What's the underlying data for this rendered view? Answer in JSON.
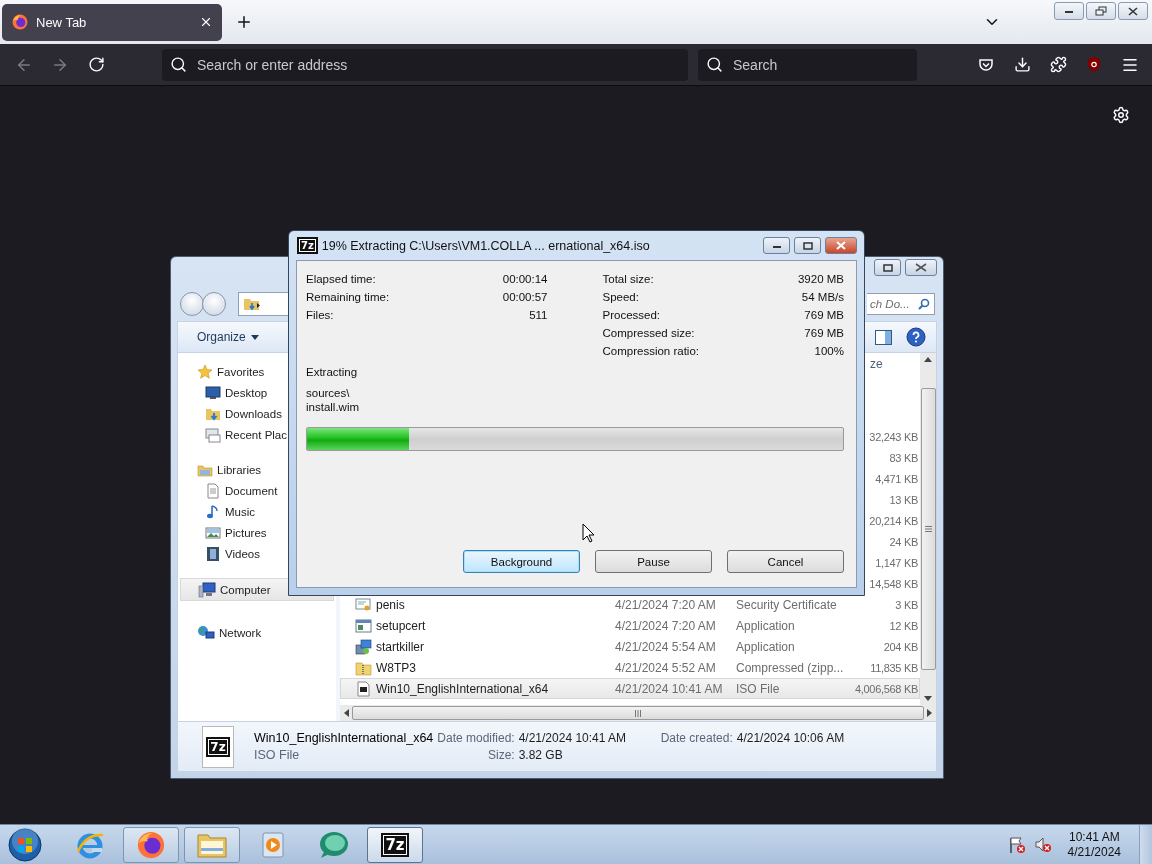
{
  "browser": {
    "tabs": [
      {
        "title": "New Tab",
        "selected": true
      }
    ],
    "nav_buttons": [
      {
        "kind": "back",
        "disabled": true
      },
      {
        "kind": "forward",
        "disabled": true
      },
      {
        "kind": "reload",
        "disabled": false
      }
    ],
    "address_placeholder": "Search or enter address",
    "search_placeholder": "Search",
    "toolbar_icons": [
      {
        "kind": "pocket"
      },
      {
        "kind": "download"
      },
      {
        "kind": "extensions"
      },
      {
        "kind": "ublock"
      },
      {
        "kind": "menu"
      }
    ]
  },
  "explorer": {
    "search_placeholder": "ch Do...",
    "organize": "Organize",
    "nav": [
      {
        "label": "Favorites",
        "kind": "favorites",
        "selected": false,
        "children": [
          {
            "label": "Desktop",
            "kind": "desktop",
            "selected": false
          },
          {
            "label": "Downloads",
            "kind": "downloads",
            "selected": false
          },
          {
            "label": "Recent Plac",
            "kind": "recent",
            "selected": false
          }
        ]
      },
      {
        "label": "Libraries",
        "kind": "libraries",
        "selected": false,
        "children": [
          {
            "label": "Document",
            "kind": "documents",
            "selected": false
          },
          {
            "label": "Music",
            "kind": "music",
            "selected": false
          },
          {
            "label": "Pictures",
            "kind": "pictures",
            "selected": false
          },
          {
            "label": "Videos",
            "kind": "videos",
            "selected": false
          }
        ]
      },
      {
        "label": "Computer",
        "kind": "computer",
        "selected": true
      },
      {
        "label": "Network",
        "kind": "network",
        "selected": false
      }
    ],
    "size_header": "ze",
    "files": [
      {
        "size": "32,243 KB",
        "selected": false
      },
      {
        "size": "83 KB",
        "selected": false
      },
      {
        "size": "4,471 KB",
        "selected": false
      },
      {
        "size": "13 KB",
        "selected": false
      },
      {
        "size": "20,214 KB",
        "selected": false
      },
      {
        "size": "24 KB",
        "selected": false
      },
      {
        "size": "1,147 KB",
        "selected": false
      },
      {
        "size": "14,548 KB",
        "selected": false
      },
      {
        "kind": "certificate",
        "name": "penis",
        "date": "4/21/2024 7:20 AM",
        "type": "Security Certificate",
        "size": "3 KB",
        "selected": false
      },
      {
        "kind": "application",
        "name": "setupcert",
        "date": "4/21/2024 7:20 AM",
        "type": "Application",
        "size": "12 KB",
        "selected": false
      },
      {
        "kind": "installer",
        "name": "startkiller",
        "date": "4/21/2024 5:54 AM",
        "type": "Application",
        "size": "204 KB",
        "selected": false
      },
      {
        "kind": "zip",
        "name": "W8TP3",
        "date": "4/21/2024 5:52 AM",
        "type": "Compressed (zipp...",
        "size": "11,835 KB",
        "selected": false
      },
      {
        "kind": "iso",
        "name": "Win10_EnglishInternational_x64",
        "date": "4/21/2024 10:41 AM",
        "type": "ISO File",
        "size": "4,006,568 KB",
        "selected": true
      }
    ],
    "details": {
      "icon_text": "7z",
      "name": "Win10_EnglishInternational_x64",
      "type": "ISO File",
      "fields": [
        {
          "label": "Date modified:",
          "value": "4/21/2024 10:41 AM"
        },
        {
          "label": "Date created:",
          "value": "4/21/2024 10:06 AM"
        },
        {
          "label": "Size:",
          "value": "3.82 GB"
        }
      ]
    }
  },
  "dialog": {
    "icon_text": "7z",
    "title": "19% Extracting C:\\Users\\VM1.COLLA ... ernational_x64.iso",
    "stats_left": [
      {
        "label": "Elapsed time:",
        "value": "00:00:14"
      },
      {
        "label": "Remaining time:",
        "value": "00:00:57"
      },
      {
        "label": "Files:",
        "value": "511"
      }
    ],
    "stats_right": [
      {
        "label": "Total size:",
        "value": "3920 MB"
      },
      {
        "label": "Speed:",
        "value": "54 MB/s"
      },
      {
        "label": "Processed:",
        "value": "769 MB"
      },
      {
        "label": "Compressed size:",
        "value": "769 MB"
      },
      {
        "label": "Compression ratio:",
        "value": "100%"
      }
    ],
    "action": "Extracting",
    "path": [
      "sources\\",
      "install.wim"
    ],
    "progress": {
      "level": 0.19
    },
    "buttons": [
      {
        "label": "Background",
        "default": true
      },
      {
        "label": "Pause",
        "default": false
      },
      {
        "label": "Cancel",
        "default": false
      }
    ]
  },
  "taskbar": {
    "items": [
      {
        "kind": "ie",
        "running": false,
        "selected": false
      },
      {
        "kind": "firefox",
        "running": true,
        "selected": false
      },
      {
        "kind": "explorer",
        "running": true,
        "selected": false
      },
      {
        "kind": "media",
        "running": false,
        "selected": false
      },
      {
        "kind": "chat",
        "running": false,
        "selected": false
      },
      {
        "kind": "sevenzip",
        "label": "7z",
        "running": true,
        "selected": true
      }
    ],
    "clock": {
      "time": "10:41 AM",
      "date": "4/21/2024"
    }
  }
}
